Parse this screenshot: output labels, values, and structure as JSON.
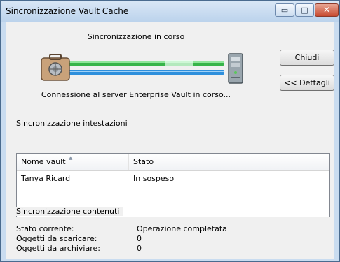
{
  "window": {
    "title": "Sincronizzazione Vault Cache",
    "controls": {
      "minimize_glyph": "▭",
      "maximize_glyph": "□",
      "close_glyph": "✕"
    }
  },
  "status": {
    "title": "Sincronizzazione in corso",
    "connection_text": "Connessione al server Enterprise Vault in corso..."
  },
  "buttons": {
    "close_label": "Chiudi",
    "details_label": "<< Dettagli"
  },
  "headers_section": {
    "title": "Sincronizzazione intestazioni",
    "columns": [
      "Nome vault",
      "Stato",
      ""
    ],
    "rows": [
      {
        "name": "Tanya Ricard",
        "status": "In sospeso"
      }
    ]
  },
  "contents_section": {
    "title": "Sincronizzazione contenuti",
    "fields": [
      {
        "label": "Stato corrente:",
        "value": "Operazione completata"
      },
      {
        "label": "Oggetti da scaricare:",
        "value": "0"
      },
      {
        "label": "Oggetti da archiviare:",
        "value": "0"
      }
    ]
  },
  "colors": {
    "progress_green": "#37b449",
    "progress_blue": "#2e8fdc",
    "title_bg": "#c9dcf0"
  },
  "icons": {
    "source": "vault-briefcase-icon",
    "target": "server-icon"
  }
}
